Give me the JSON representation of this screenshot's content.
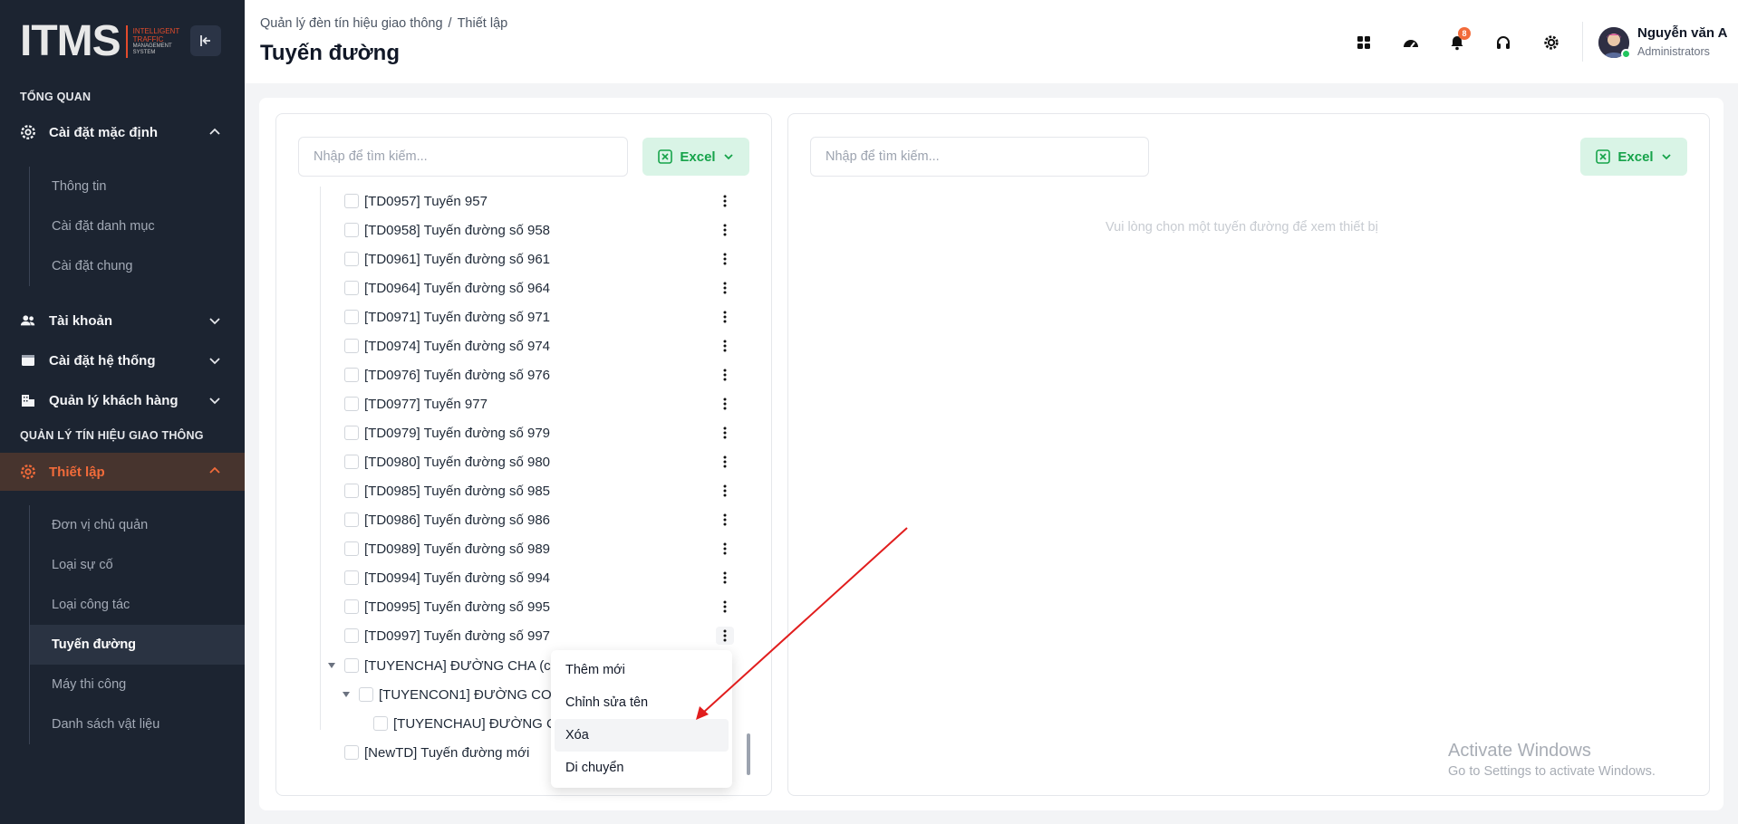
{
  "logo": {
    "main": "ITMS",
    "sub": [
      "INTELLIGENT",
      "TRAFFIC",
      "MANAGEMENT",
      "SYSTEM"
    ]
  },
  "sidebar": {
    "section_overview": "TỔNG QUAN",
    "default_settings": "Cài đặt mặc định",
    "default_sub": [
      "Thông tin",
      "Cài đặt danh mục",
      "Cài đặt chung"
    ],
    "account": "Tài khoản",
    "system_settings": "Cài đặt hệ thống",
    "customers": "Quản lý khách hàng",
    "section_traffic": "QUẢN LÝ TÍN HIỆU GIAO THÔNG",
    "setup": "Thiết lập",
    "setup_sub": [
      "Đơn vị chủ quản",
      "Loại sự cố",
      "Loại công tác",
      "Tuyến đường",
      "Máy thi công",
      "Danh sách vật liệu"
    ]
  },
  "header": {
    "breadcrumb": [
      "Quản lý đèn tín hiệu giao thông",
      "Thiết lập"
    ],
    "title": "Tuyến đường",
    "notification_count": "8",
    "user_name": "Nguyễn văn A",
    "user_role": "Administrators"
  },
  "left_panel": {
    "search_placeholder": "Nhập để tìm kiếm...",
    "excel_label": "Excel",
    "rows": [
      "[TD0957] Tuyến 957",
      "[TD0958] Tuyến đường số 958",
      "[TD0961] Tuyến đường số 961",
      "[TD0964] Tuyến đường số 964",
      "[TD0971] Tuyến đường số 971",
      "[TD0974] Tuyến đường số 974",
      "[TD0976] Tuyến đường số 976",
      "[TD0977] Tuyến 977",
      "[TD0979] Tuyến đường số 979",
      "[TD0980] Tuyến đường số 980",
      "[TD0985] Tuyến đường số 985",
      "[TD0986] Tuyến đường số 986",
      "[TD0989] Tuyến đường số 989",
      "[TD0994] Tuyến đường số 994",
      "[TD0995] Tuyến đường số 995",
      "[TD0997] Tuyến đường số 997"
    ],
    "parent": "[TUYENCHA] ĐƯỜNG CHA (cấ",
    "child": "[TUYENCON1] ĐƯỜNG CON",
    "grandchild": "[TUYENCHAU] ĐƯỜNG C",
    "last": "[NewTD] Tuyến đường mới"
  },
  "context_menu": [
    "Thêm mới",
    "Chỉnh sửa tên",
    "Xóa",
    "Di chuyển"
  ],
  "right_panel": {
    "search_placeholder": "Nhập để tìm kiếm...",
    "excel_label": "Excel",
    "empty_message": "Vui lòng chọn một tuyến đường để xem thiết bị"
  },
  "watermark": {
    "title": "Activate Windows",
    "subtitle": "Go to Settings to activate Windows."
  },
  "colors": {
    "accent": "#f26b3a",
    "sidebar_bg": "#1c2431",
    "excel_green": "#16a34a",
    "annotation_arrow": "#e11d1d"
  }
}
